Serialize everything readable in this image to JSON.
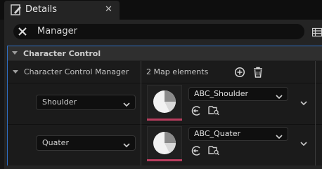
{
  "tab": {
    "title": "Details",
    "icon": "pencil-icon",
    "close_icon": "close-icon",
    "close_glyph": "✕"
  },
  "search": {
    "value": "Manager",
    "clear_icon": "clear-icon",
    "view_icon": "grid-view-icon"
  },
  "category": {
    "label": "Character Control"
  },
  "property": {
    "label": "Character Control Manager",
    "count": "2 Map elements",
    "add_icon": "add-element-icon",
    "delete_icon": "trash-icon"
  },
  "entries": [
    {
      "key": "Shoulder",
      "asset": "ABC_Shoulder"
    },
    {
      "key": "Quater",
      "asset": "ABC_Quater"
    }
  ],
  "colors": {
    "accent_border": "#2f6fc4",
    "thumbnail_bar": "#b83d5e",
    "panel_bg": "#242424"
  }
}
